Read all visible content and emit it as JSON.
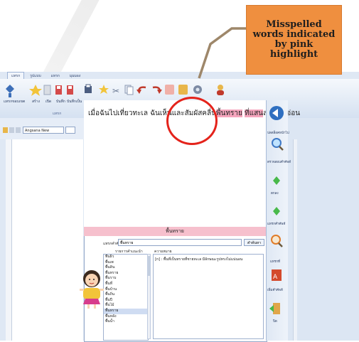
{
  "callout": {
    "text": "Misspelled words indicated by pink highlight"
  },
  "ribbon": {
    "tabs": [
      {
        "label": "แทรก",
        "active": true
      },
      {
        "label": "รูปแบบ",
        "active": false
      },
      {
        "label": "แทรก",
        "active": false
      },
      {
        "label": "มุมมอง",
        "active": false
      }
    ],
    "buttons": [
      {
        "label": "แทรกขอบเขต"
      },
      {
        "label": "สร้าง"
      },
      {
        "label": "เปิด"
      },
      {
        "label": "บันทึก"
      },
      {
        "label": "บันทึกเป็น"
      }
    ],
    "group_label": "แทรก"
  },
  "font": {
    "name": "Angsana New"
  },
  "editor": {
    "text_before": "เมื่อฉันไปเที่ยวทะเล ฉันเห็นและสัมผัสคลื่น",
    "misspelled_1": "พื้นทราย",
    "text_mid": " ",
    "misspelled_2": "ที่แสน",
    "text_after": "ละเอียดอ่อน"
  },
  "word_panel": {
    "header": "พื้นทราย",
    "search_label": "แทรกคำศัพท์",
    "search_value": "พื้นทราย",
    "search_button": "คำค้นหา",
    "suggestions_header": "รายการคำแนะนำ",
    "meaning_header": "ความหมาย",
    "meaning_text": "[n] : พื้นที่เป็นทรายที่ชายทะเล มีลักษณะรูปทรงไม่แน่นอน",
    "suggestions": [
      "พื้นผิว",
      "พื้นเพ",
      "พื้นดิน",
      "พื้นทราย",
      "พื้นราบ",
      "พื้นที่",
      "พื้นบ้าน",
      "พื้นถิ่น",
      "พื้นปี",
      "พื้นไม้",
      "พื้นทราย",
      "พื้นหลัง",
      "พื้นน้ำ"
    ],
    "selected_index": 10
  },
  "sidebar": {
    "items": [
      {
        "label": "ปลดล็อคหน้าไป",
        "icon": "globe-arrow-icon"
      },
      {
        "label": "ตรวจสอบคำศัพท์",
        "icon": "magnifier-icon"
      },
      {
        "label": "ตกลง",
        "icon": "green-diamond-icon"
      },
      {
        "label": "แทรกคำศัพท์",
        "icon": "green-diamond-icon"
      },
      {
        "label": "แทรกที่",
        "icon": "magnifier-icon"
      },
      {
        "label": "เพิ่มคำศัพท์",
        "icon": "book-icon"
      },
      {
        "label": "ปิด",
        "icon": "exit-door-icon"
      }
    ]
  },
  "colors": {
    "highlight_pink": "#f5a5bd",
    "callout_orange": "#ef8f3f",
    "circle_red": "#e4231b",
    "header_pink": "#f6c0cd"
  }
}
